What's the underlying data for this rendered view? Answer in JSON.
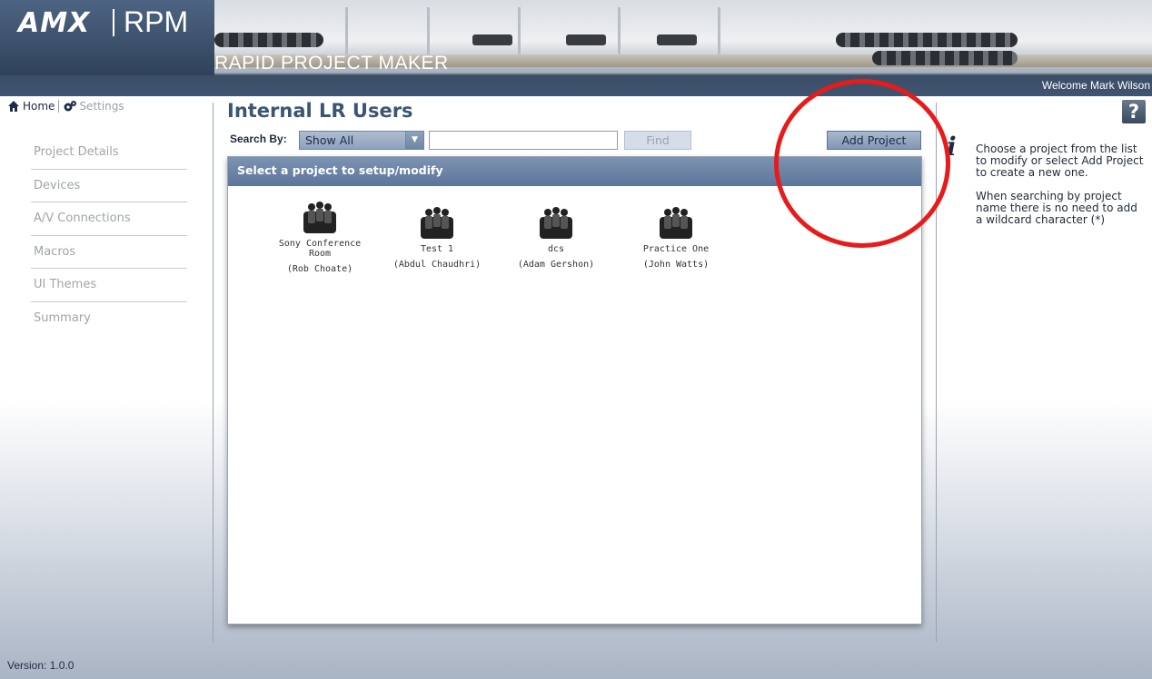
{
  "header": {
    "brand_amx": "AMX",
    "brand_rpm": "RPM",
    "app_title": "RAPID PROJECT MAKER",
    "welcome": "Welcome Mark Wilson"
  },
  "topnav": {
    "home": "Home",
    "settings": "Settings"
  },
  "steps": [
    "Project Details",
    "Devices",
    "A/V Connections",
    "Macros",
    "UI Themes",
    "Summary"
  ],
  "page_title": "Internal LR Users",
  "search": {
    "label": "Search By:",
    "selected": "Show All",
    "value": "",
    "find_label": "Find"
  },
  "add_project_label": "Add Project",
  "panel_header": "Select a project to setup/modify",
  "projects": [
    {
      "name": "Sony Conference Room",
      "owner": "(Rob Choate)"
    },
    {
      "name": "Test 1",
      "owner": "(Abdul Chaudhri)"
    },
    {
      "name": "dcs",
      "owner": "(Adam Gershon)"
    },
    {
      "name": "Practice One",
      "owner": "(John Watts)"
    }
  ],
  "help": {
    "button": "?",
    "info_glyph": "i",
    "paragraph1": "Choose a project from the list to modify or select Add Project to create a new one.",
    "paragraph2": "When searching by project name there is no need to add a wildcard character (*)"
  },
  "version": "Version: 1.0.0",
  "colors": {
    "accent_dark": "#3b5673",
    "panel_header": "#5c759a",
    "annotation": "#e81b1b"
  }
}
